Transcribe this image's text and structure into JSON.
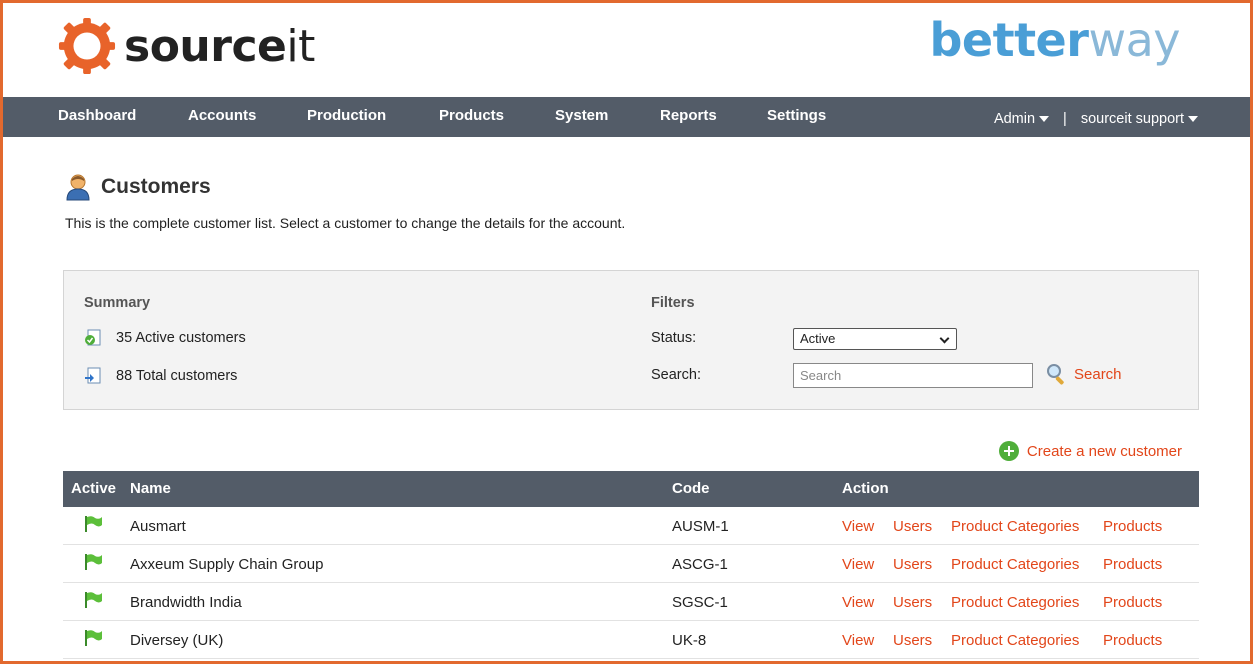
{
  "brand": {
    "left_logo": {
      "bold": "source",
      "thin": "it"
    },
    "right_logo": {
      "bold": "better",
      "light": "way"
    },
    "accent_orange": "#e2692e",
    "link_red": "#e2461a",
    "nav_bg": "#535c68"
  },
  "nav": {
    "items": [
      "Dashboard",
      "Accounts",
      "Production",
      "Products",
      "System",
      "Reports",
      "Settings"
    ],
    "admin_label": "Admin",
    "separator": "|",
    "support_label": "sourceit support"
  },
  "page": {
    "title": "Customers",
    "description": "This is the complete customer list. Select a customer to change the details for the account."
  },
  "summary": {
    "heading": "Summary",
    "active": "35 Active customers",
    "total": "88 Total customers"
  },
  "filters": {
    "heading": "Filters",
    "status_label": "Status:",
    "status_value": "Active",
    "search_label": "Search:",
    "search_placeholder": "Search",
    "search_button": "Search"
  },
  "create_link": "Create a new customer",
  "table": {
    "headers": {
      "active": "Active",
      "name": "Name",
      "code": "Code",
      "action": "Action"
    },
    "actions": {
      "view": "View",
      "users": "Users",
      "categories": "Product Categories",
      "products": "Products"
    },
    "rows": [
      {
        "name": "Ausmart",
        "code": "AUSM-1"
      },
      {
        "name": "Axxeum Supply Chain Group",
        "code": "ASCG-1"
      },
      {
        "name": "Brandwidth India",
        "code": "SGSC-1"
      },
      {
        "name": "Diversey (UK)",
        "code": "UK-8"
      }
    ]
  }
}
